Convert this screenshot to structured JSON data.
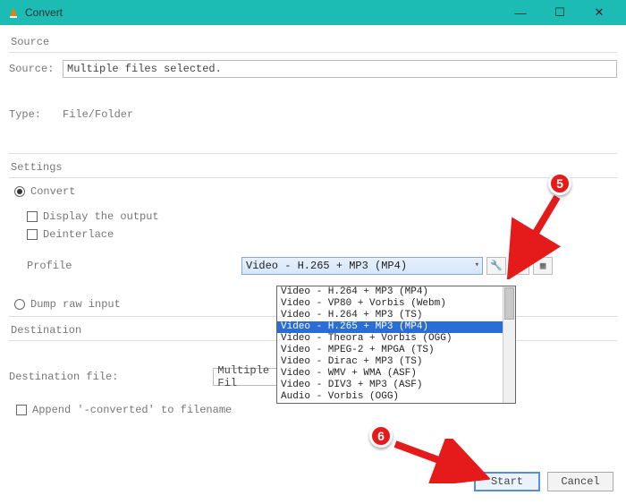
{
  "window": {
    "title": "Convert"
  },
  "source": {
    "section_label": "Source",
    "source_label": "Source:",
    "source_value": "Multiple files selected.",
    "type_label": "Type:",
    "type_value": "File/Folder"
  },
  "settings": {
    "section_label": "Settings",
    "convert_label": "Convert",
    "display_output_label": "Display the output",
    "deinterlace_label": "Deinterlace",
    "profile_label": "Profile",
    "profile_selected": "Video - H.265 + MP3 (MP4)",
    "profile_options": [
      "Video - H.264 + MP3 (MP4)",
      "Video - VP80 + Vorbis (Webm)",
      "Video - H.264 + MP3 (TS)",
      "Video - H.265 + MP3 (MP4)",
      "Video - Theora + Vorbis (OGG)",
      "Video - MPEG-2 + MPGA (TS)",
      "Video - Dirac + MP3 (TS)",
      "Video - WMV + WMA (ASF)",
      "Video - DIV3 + MP3 (ASF)",
      "Audio - Vorbis (OGG)"
    ],
    "profile_selected_index": 3,
    "dump_raw_label": "Dump raw input"
  },
  "destination": {
    "section_label": "Destination",
    "dest_file_label": "Destination file:",
    "dest_file_value": "Multiple Fil",
    "append_label": "Append '-converted' to filename"
  },
  "footer": {
    "start_label": "Start",
    "cancel_label": "Cancel"
  },
  "callouts": {
    "n5": "5",
    "n6": "6"
  },
  "icons": {
    "wrench": "🔧",
    "delete": "✕",
    "new": "▦"
  }
}
